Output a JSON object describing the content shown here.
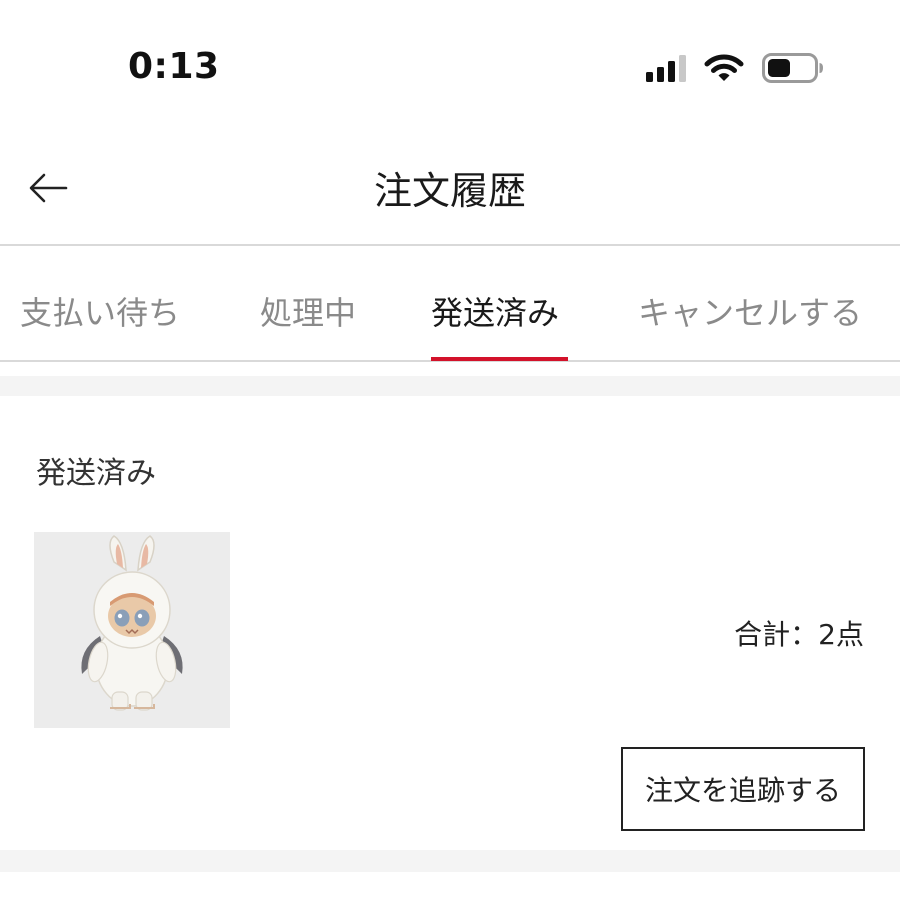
{
  "status_bar": {
    "time": "0:13",
    "icons": [
      "signal-icon",
      "wifi-icon",
      "battery-icon"
    ],
    "battery_level": 0.5
  },
  "header": {
    "title": "注文履歴",
    "back_icon": "arrow-left-icon"
  },
  "tabs": [
    {
      "label": "支払い待ち",
      "active": false
    },
    {
      "label": "処理中",
      "active": false
    },
    {
      "label": "発送済み",
      "active": true
    },
    {
      "label": "キャンセルする",
      "active": false
    }
  ],
  "order": {
    "status": "発送済み",
    "product_image": "white-bunny-figure-thumbnail",
    "total_label": "合計：",
    "total_value": "2点",
    "track_button_label": "注文を追跡する"
  },
  "colors": {
    "accent": "#d3122a",
    "background": "#ffffff",
    "divider": "#d9d9d9",
    "band": "#f4f4f4",
    "text_primary": "#1a1a1a",
    "text_inactive": "#8a8a8a"
  }
}
